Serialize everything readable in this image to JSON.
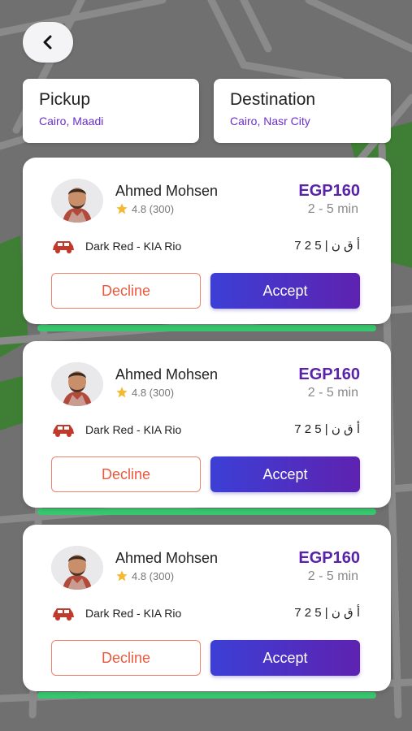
{
  "pickup": {
    "title": "Pickup",
    "subtitle": "Cairo, Maadi"
  },
  "destination": {
    "title": "Destination",
    "subtitle": "Cairo, Nasr City"
  },
  "offers": [
    {
      "driver_name": "Ahmed Mohsen",
      "rating": "4.8 (300)",
      "price": "EGP160",
      "eta": "2 - 5 min",
      "car": "Dark Red - KIA Rio",
      "plate": "أ ق ن | 5 2 7",
      "decline_label": "Decline",
      "accept_label": "Accept"
    },
    {
      "driver_name": "Ahmed Mohsen",
      "rating": "4.8 (300)",
      "price": "EGP160",
      "eta": "2 - 5 min",
      "car": "Dark Red - KIA Rio",
      "plate": "أ ق ن | 5 2 7",
      "decline_label": "Decline",
      "accept_label": "Accept"
    },
    {
      "driver_name": "Ahmed Mohsen",
      "rating": "4.8 (300)",
      "price": "EGP160",
      "eta": "2 - 5 min",
      "car": "Dark Red - KIA Rio",
      "plate": "أ ق ن | 5 2 7",
      "decline_label": "Decline",
      "accept_label": "Accept"
    }
  ],
  "icons": {
    "back": "chevron-left-icon",
    "star": "star-icon",
    "car": "car-icon"
  },
  "colors": {
    "price": "#5a22a8",
    "decline": "#e9593f",
    "accept_start": "#3c3fd6",
    "accept_end": "#5e22b0",
    "star": "#f5b82e",
    "car": "#c0392b",
    "status_bar": "#37c86e"
  }
}
